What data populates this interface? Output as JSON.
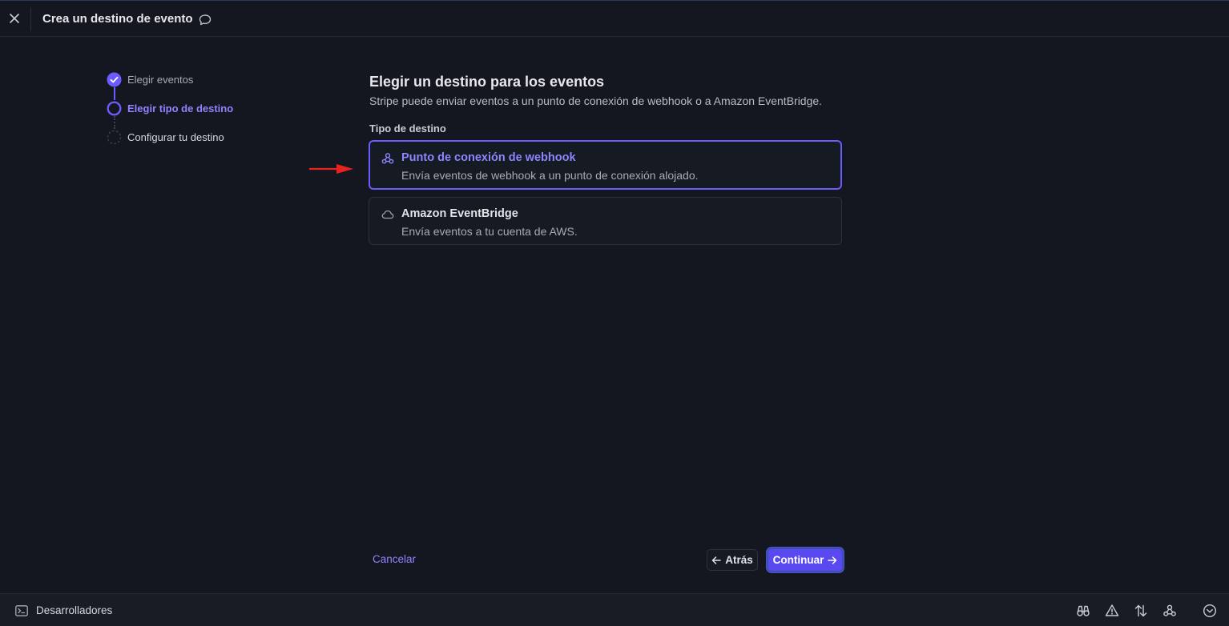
{
  "header": {
    "title": "Crea un destino de evento"
  },
  "stepper": {
    "steps": [
      {
        "label": "Elegir eventos",
        "state": "completed"
      },
      {
        "label": "Elegir tipo de destino",
        "state": "current"
      },
      {
        "label": "Configurar tu destino",
        "state": "pending"
      }
    ]
  },
  "main": {
    "heading": "Elegir un destino para los eventos",
    "subheading": "Stripe puede enviar eventos a un punto de conexión de webhook o a Amazon EventBridge.",
    "field_label": "Tipo de destino",
    "options": [
      {
        "title": "Punto de conexión de webhook",
        "description": "Envía eventos de webhook a un punto de conexión alojado.",
        "icon": "webhook-icon",
        "selected": true
      },
      {
        "title": "Amazon EventBridge",
        "description": "Envía eventos a tu cuenta de AWS.",
        "icon": "cloud-icon",
        "selected": false
      }
    ]
  },
  "footer": {
    "cancel_label": "Cancelar",
    "back_label": "Atrás",
    "continue_label": "Continuar"
  },
  "bottombar": {
    "developers_label": "Desarrolladores",
    "icons": [
      "binoculars-icon",
      "warning-icon",
      "transfer-icon",
      "webhook-icon",
      "chevron-circle-icon"
    ]
  },
  "colors": {
    "accent": "#6b5cff",
    "accent_text": "#8f84ff",
    "background": "#14171f",
    "annotation_arrow": "#e8231f"
  }
}
